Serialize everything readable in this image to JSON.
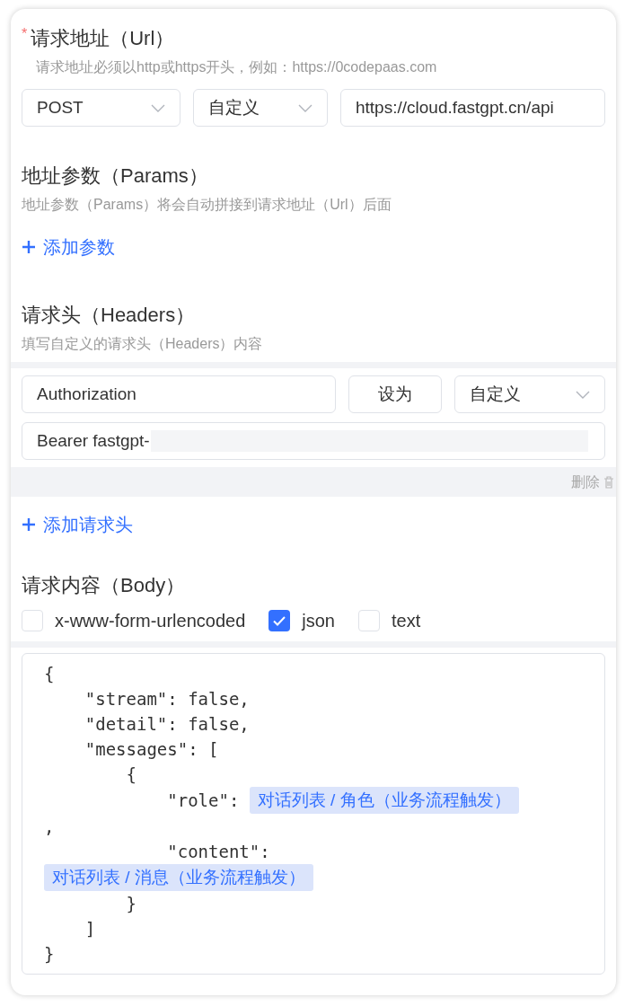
{
  "url_section": {
    "title": "请求地址（Url）",
    "required_mark": "*",
    "hint": "请求地址必须以http或https开头，例如：https://0codepaas.com",
    "method": "POST",
    "source": "自定义",
    "url": "https://cloud.fastgpt.cn/api"
  },
  "params_section": {
    "title": "地址参数（Params）",
    "hint": "地址参数（Params）将会自动拼接到请求地址（Url）后面",
    "add_label": "添加参数"
  },
  "headers_section": {
    "title": "请求头（Headers）",
    "hint": "填写自定义的请求头（Headers）内容",
    "headers": [
      {
        "key": "Authorization",
        "set_label": "设为",
        "source": "自定义",
        "value": "Bearer fastgpt-",
        "value_redacted": true,
        "delete_label": "删除"
      }
    ],
    "add_label": "添加请求头"
  },
  "body_section": {
    "title": "请求内容（Body）",
    "types": [
      {
        "label": "x-www-form-urlencoded",
        "checked": false
      },
      {
        "label": "json",
        "checked": true
      },
      {
        "label": "text",
        "checked": false
      }
    ],
    "code_lines": [
      [
        {
          "kind": "code",
          "text": "{"
        }
      ],
      [
        {
          "kind": "code",
          "text": "    \"stream\": false,"
        }
      ],
      [
        {
          "kind": "code",
          "text": "    \"detail\": false,"
        }
      ],
      [
        {
          "kind": "code",
          "text": "    \"messages\": ["
        }
      ],
      [
        {
          "kind": "code",
          "text": "        {"
        }
      ],
      [
        {
          "kind": "code",
          "text": "            \"role\": "
        },
        {
          "kind": "variable",
          "text": "对话列表 / 角色（业务流程触发）"
        }
      ],
      [
        {
          "kind": "code",
          "text": ","
        }
      ],
      [
        {
          "kind": "code",
          "text": "            \"content\":"
        }
      ],
      [
        {
          "kind": "variable",
          "text": "对话列表 / 消息（业务流程触发）"
        }
      ],
      [
        {
          "kind": "code",
          "text": "        }"
        }
      ],
      [
        {
          "kind": "code",
          "text": "    ]"
        }
      ],
      [
        {
          "kind": "code",
          "text": "}"
        }
      ]
    ]
  }
}
